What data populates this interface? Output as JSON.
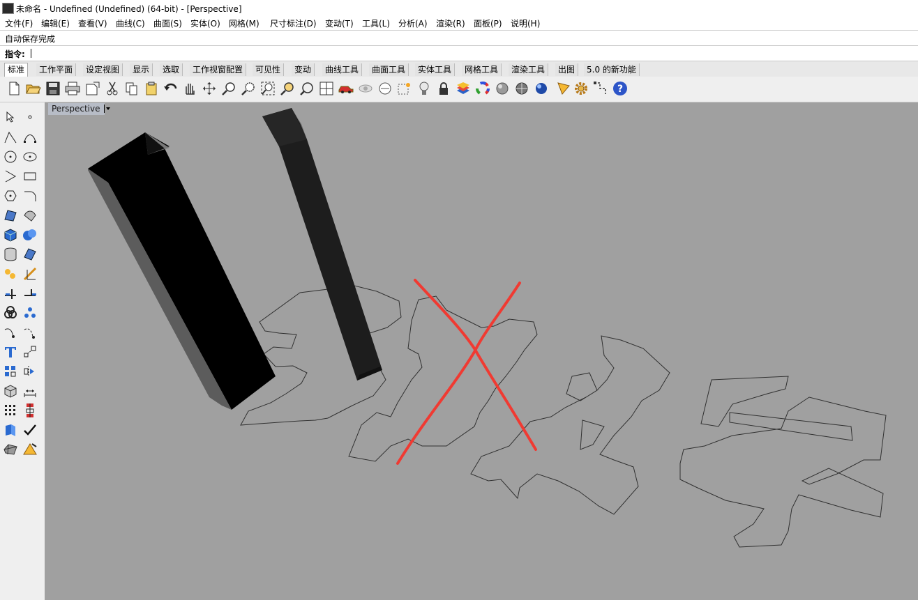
{
  "window": {
    "title": "未命名 - Undefined (Undefined) (64-bit) - [Perspective]"
  },
  "menu": [
    "文件(F)",
    "编辑(E)",
    "查看(V)",
    "曲线(C)",
    "曲面(S)",
    "实体(O)",
    "网格(M)",
    "尺寸标注(D)",
    "变动(T)",
    "工具(L)",
    "分析(A)",
    "渲染(R)",
    "面板(P)",
    "说明(H)"
  ],
  "status": {
    "message": "自动保存完成"
  },
  "command": {
    "prompt": "指令:"
  },
  "tabs": [
    "标准",
    "工作平面",
    "设定视图",
    "显示",
    "选取",
    "工作视窗配置",
    "可见性",
    "变动",
    "曲线工具",
    "曲面工具",
    "实体工具",
    "网格工具",
    "渲染工具",
    "出图",
    "5.0 的新功能"
  ],
  "toolbar_icons": [
    "new-icon",
    "open-icon",
    "save-icon",
    "print-icon",
    "import-icon",
    "cut-icon",
    "copy-icon",
    "paste-icon",
    "undo-icon",
    "pan-hand-icon",
    "move-view-icon",
    "zoom-dynamic-icon",
    "zoom-window-icon",
    "zoom-extents-icon",
    "zoom-selected-icon",
    "rotate-view-icon",
    "four-view-icon",
    "car-icon",
    "hide-icon",
    "show-icon",
    "lock-point-icon",
    "light-bulb-icon",
    "lock-icon",
    "layer-icon",
    "color-wheel-icon",
    "shaded-sphere-icon",
    "rendered-sphere-icon",
    "render-sphere-icon",
    "options-icon",
    "gear-icon",
    "snap-icon",
    "help-icon"
  ],
  "left_tools": [
    "select-arrow-icon",
    "point-icon",
    "polyline-icon",
    "curve-control-points-icon",
    "circle-icon",
    "ellipse-icon",
    "arc-icon",
    "rectangle-icon",
    "polygon-icon",
    "fillet-curve-icon",
    "surface-corner-icon",
    "surface-loft-icon",
    "box-icon",
    "sphere-union-icon",
    "cylinder-icon",
    "surface-patch-icon",
    "explode-icon",
    "trim-icon",
    "split-icon",
    "extend-icon",
    "boolean-icon",
    "group-icon",
    "offset-icon",
    "blend-icon",
    "text-icon",
    "scale-icon",
    "array-icon",
    "mirror-icon",
    "solid-edit-icon",
    "dimension-icon",
    "grid-icon",
    "align-icon",
    "extrude-icon",
    "check-icon",
    "mesh-icon",
    "render-icon"
  ],
  "viewport": {
    "label": "Perspective"
  },
  "colors": {
    "viewport_bg": "#a0a0a0",
    "annotation_red": "#f03a32"
  }
}
